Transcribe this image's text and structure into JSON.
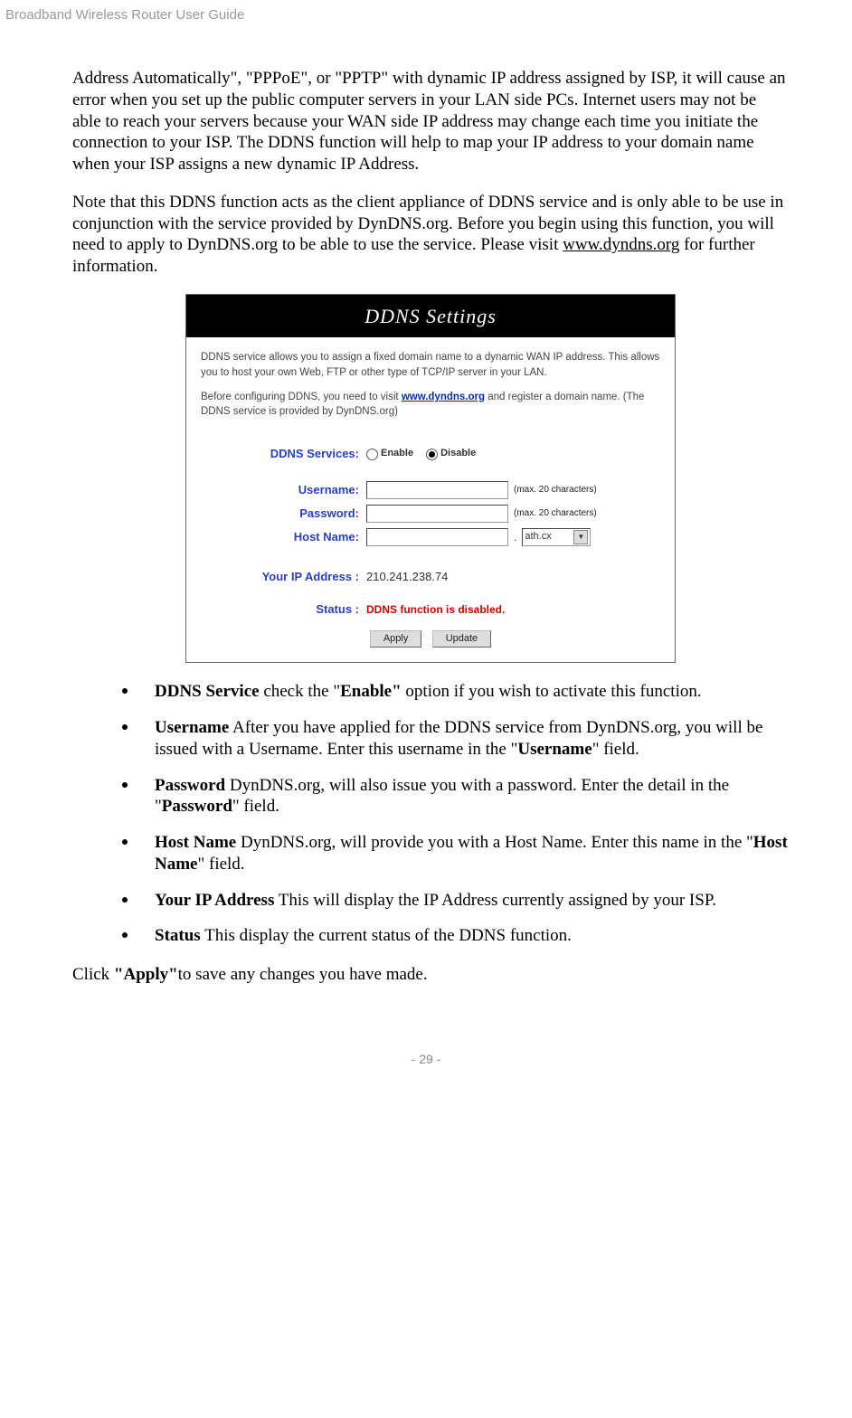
{
  "header": "Broadband Wireless Router User Guide",
  "para1": "Address Automatically\", \"PPPoE\", or \"PPTP\" with dynamic IP address assigned by ISP, it will cause an error when you set up the public computer servers in your LAN side PCs. Internet users may not be able to reach your servers because your WAN side IP address may change each time you initiate the connection to your ISP. The DDNS function will help to map your IP address to your domain name when your ISP assigns a new dynamic IP Address.",
  "para2_a": "Note that this DDNS function acts as the client appliance of DDNS service and is only able to be use in conjunction with the service provided by DynDNS.org. Before you begin using this function, you will need to apply to DynDNS.org to be able to use the service. Please visit ",
  "para2_link": "www.dyndns.org",
  "para2_b": " for further information.",
  "screenshot": {
    "title": "DDNS Settings",
    "intro1": "DDNS service allows you to assign a fixed domain name to a dynamic WAN IP address. This allows you to host your own Web, FTP or other type of TCP/IP server in your LAN.",
    "intro2_a": "Before configuring DDNS, you need to visit ",
    "intro2_link": "www.dyndns.org",
    "intro2_b": " and register a domain name. (The DDNS service is provided by DynDNS.org)",
    "labels": {
      "services": "DDNS Services:",
      "enable": "Enable",
      "disable": "Disable",
      "username": "Username:",
      "password": "Password:",
      "hostname": "Host Name:",
      "your_ip": "Your IP Address :",
      "status": "Status :"
    },
    "hint": "(max. 20 characters)",
    "dot": ".",
    "select_val": "ath.cx",
    "ip_value": "210.241.238.74",
    "status_value": "DDNS function is disabled.",
    "btn_apply": "Apply",
    "btn_update": "Update"
  },
  "bullets": {
    "b1_a": "DDNS Service",
    "b1_b": " check the \"",
    "b1_c": "Enable\"",
    "b1_d": " option if you wish to activate this function.",
    "b2_a": "Username",
    "b2_b": " After you have applied for the DDNS service from DynDNS.org, you will be issued with a Username. Enter this username in the \"",
    "b2_c": "Username",
    "b2_d": "\" field.",
    "b3_a": "Password",
    "b3_b": " DynDNS.org, will also issue you with a password. Enter the detail in the \"",
    "b3_c": "Password",
    "b3_d": "\" field.",
    "b4_a": "Host Name",
    "b4_b": " DynDNS.org, will provide you with a Host Name. Enter this name in the \"",
    "b4_c": "Host Name",
    "b4_d": "\" field.",
    "b5_a": "Your IP Address",
    "b5_b": " This will display the IP Address currently assigned by your ISP.",
    "b6_a": "Status",
    "b6_b": " This display the current status of the DDNS function."
  },
  "closing_a": "Click ",
  "closing_b": "\"Apply\"",
  "closing_c": "to save any changes you have made.",
  "footer": "- 29 -"
}
